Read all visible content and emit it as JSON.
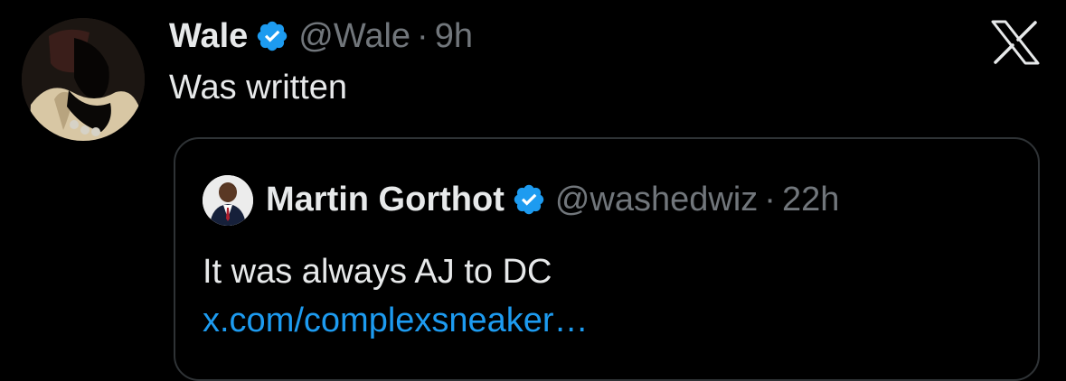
{
  "tweet": {
    "author_name": "Wale",
    "author_handle": "@Wale",
    "separator": "·",
    "time": "9h",
    "text": "Was written"
  },
  "quote": {
    "author_name": "Martin Gorthot",
    "author_handle": "@washedwiz",
    "separator": "·",
    "time": "22h",
    "text": "It was always AJ to DC",
    "link_text": "x.com/complexsneaker…"
  },
  "icons": {
    "verified": "verified-badge-icon",
    "logo": "x-logo-icon"
  },
  "colors": {
    "background": "#000000",
    "primary_text": "#e7e9ea",
    "secondary_text": "#71767b",
    "link": "#1d9bf0",
    "verified_badge": "#1d9bf0",
    "border": "#2f3336"
  }
}
